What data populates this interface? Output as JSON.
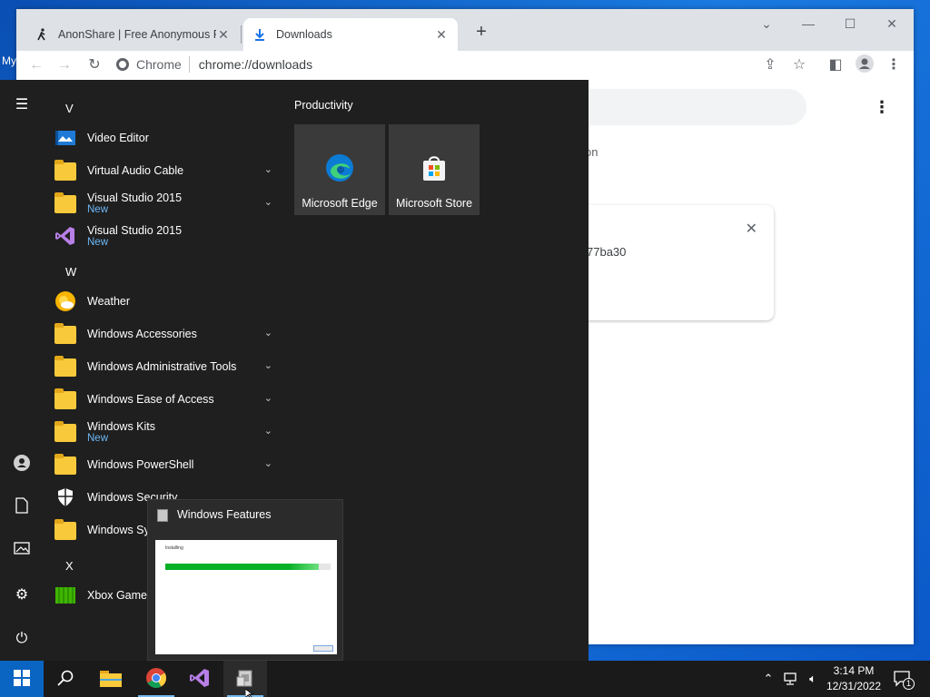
{
  "desktop": {
    "label": "My"
  },
  "browser": {
    "tabs": [
      {
        "label": "AnonShare | Free Anonymous Fil",
        "icon": "walker-icon"
      },
      {
        "label": "Downloads",
        "icon": "download-icon"
      }
    ],
    "omnibox": {
      "site": "Chrome",
      "url": "chrome://downloads"
    },
    "page": {
      "fragment_text": "on",
      "card_text": "77ba30"
    }
  },
  "start_menu": {
    "letters": [
      "V",
      "W",
      "X"
    ],
    "apps": [
      {
        "name": "Video Editor",
        "new": ""
      },
      {
        "name": "Virtual Audio Cable",
        "new": ""
      },
      {
        "name": "Visual Studio 2015",
        "new": "New"
      },
      {
        "name": "Visual Studio 2015",
        "new": "New"
      },
      {
        "name": "Weather",
        "new": ""
      },
      {
        "name": "Windows Accessories",
        "new": ""
      },
      {
        "name": "Windows Administrative Tools",
        "new": ""
      },
      {
        "name": "Windows Ease of Access",
        "new": ""
      },
      {
        "name": "Windows Kits",
        "new": "New"
      },
      {
        "name": "Windows PowerShell",
        "new": ""
      },
      {
        "name": "Windows Security",
        "new": ""
      },
      {
        "name": "Windows Syste",
        "new": ""
      },
      {
        "name": "Xbox Game B",
        "new": ""
      }
    ],
    "tiles_group": "Productivity",
    "tiles": [
      {
        "name": "Microsoft Edge"
      },
      {
        "name": "Microsoft Store"
      }
    ]
  },
  "thumbnail": {
    "title": "Windows Features",
    "window_text": "Installing",
    "progress": 0.93
  },
  "taskbar": {
    "time": "3:14 PM",
    "date": "12/31/2022",
    "notification_count": "1"
  },
  "colors": {
    "accent": "#0a64c2",
    "new_badge": "#6cb8f6",
    "folder": "#f8c93a",
    "progress": "#06b025"
  }
}
